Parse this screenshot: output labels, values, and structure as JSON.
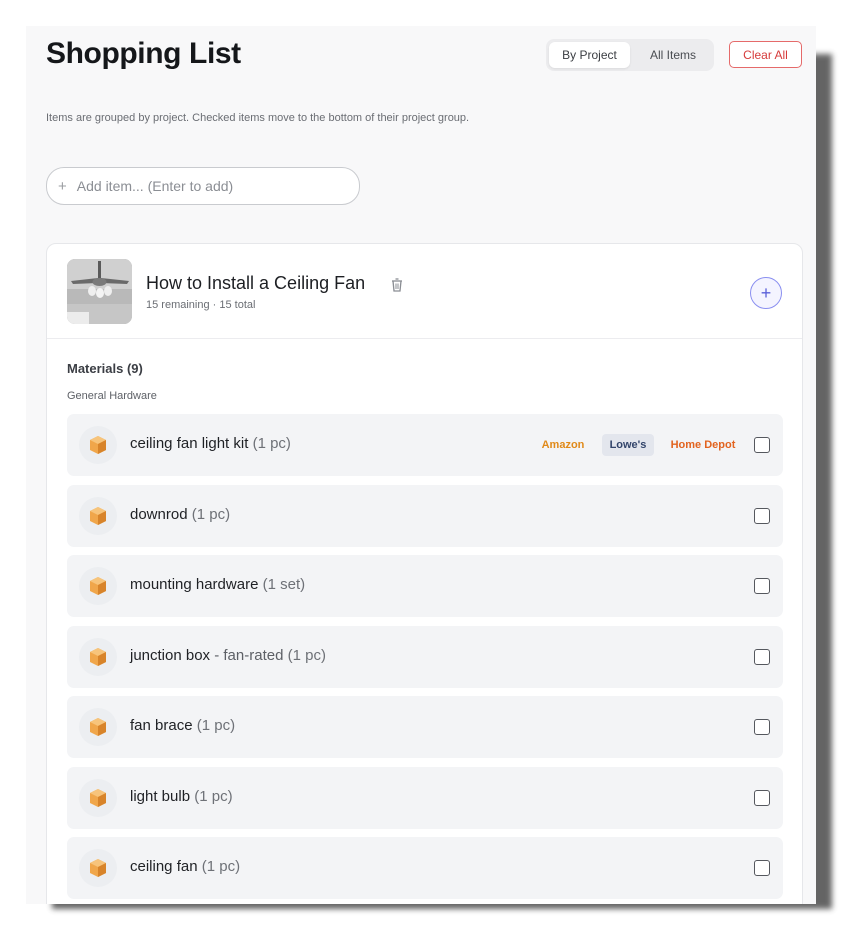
{
  "header": {
    "title": "Shopping List",
    "view_tabs": [
      "By Project",
      "All Items"
    ],
    "active_tab": "By Project",
    "clear_label": "Clear All"
  },
  "subtitle": "Items are grouped by project. Checked items move to the bottom of their project group.",
  "add_input": {
    "plus": "+",
    "placeholder": "Add item... (Enter to add)"
  },
  "project": {
    "title": "How to Install a Ceiling Fan",
    "meta": "15 remaining · 15 total",
    "add_symbol": "+",
    "section": "Materials (9)",
    "group": "General Hardware",
    "items": [
      {
        "name": "ceiling fan light kit",
        "note": "",
        "qty": "(1 pc)",
        "icon": "package-icon",
        "checked": false,
        "stores": [
          "Amazon",
          "Lowe's",
          "Home Depot"
        ]
      },
      {
        "name": "downrod",
        "note": "",
        "qty": "(1 pc)",
        "icon": "package-icon",
        "checked": false
      },
      {
        "name": "mounting hardware",
        "note": "",
        "qty": "(1 set)",
        "icon": "package-icon",
        "checked": false
      },
      {
        "name": "junction box",
        "note": " - fan-rated",
        "qty": "(1 pc)",
        "icon": "package-icon",
        "checked": false
      },
      {
        "name": "fan brace",
        "note": "",
        "qty": "(1 pc)",
        "icon": "package-icon",
        "checked": false
      },
      {
        "name": "light bulb",
        "note": "",
        "qty": "(1 pc)",
        "icon": "package-icon",
        "checked": false
      },
      {
        "name": "ceiling fan",
        "note": "",
        "qty": "(1 pc)",
        "icon": "package-icon",
        "checked": false
      }
    ]
  },
  "colors": {
    "amazon": "#e08a1a",
    "lowes": "#33456b",
    "home_depot": "#e2631f",
    "clear": "#d63b3b",
    "accent": "#5a60d8"
  }
}
